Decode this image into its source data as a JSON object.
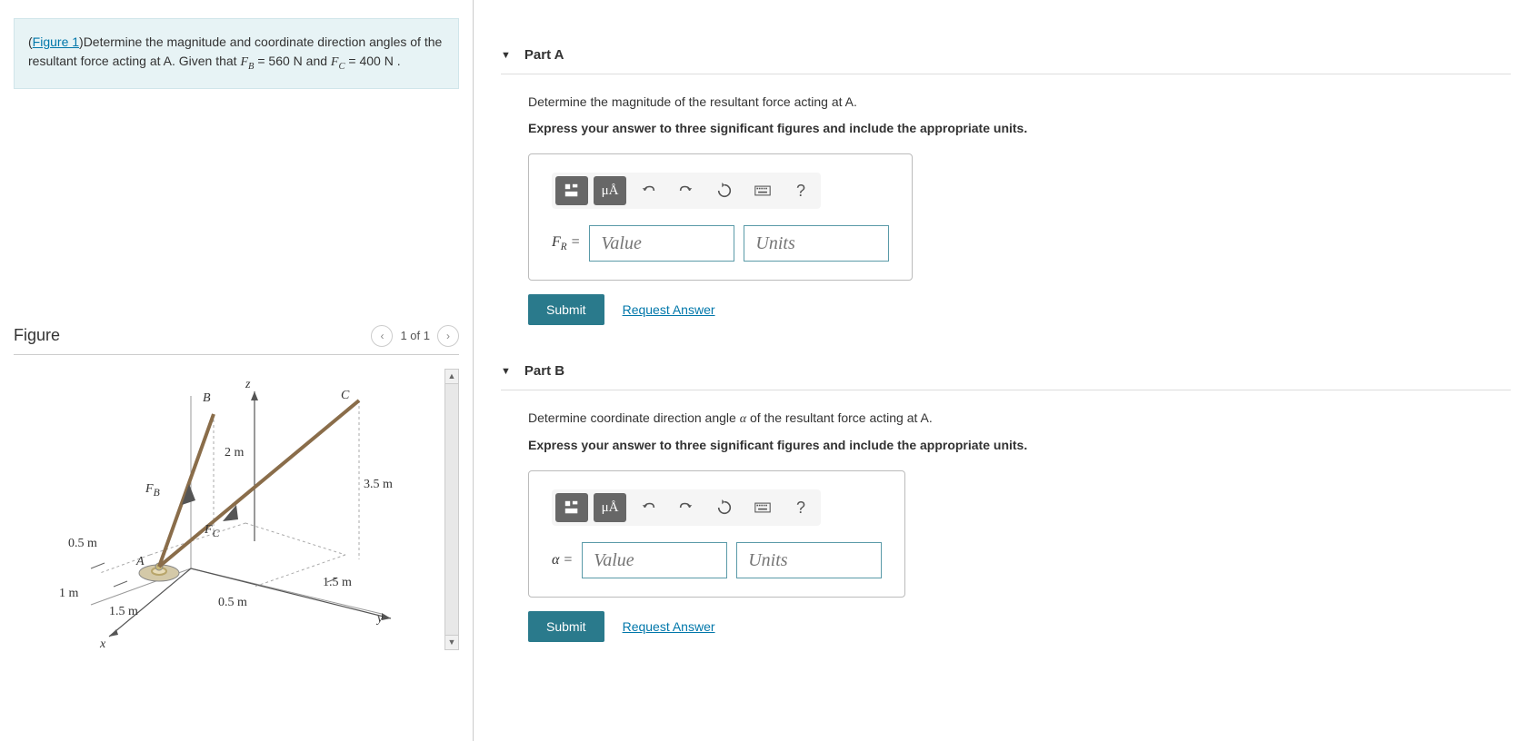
{
  "problem": {
    "figure_link": "Figure 1",
    "text_before": "(",
    "text_after_link": ")Determine the magnitude and coordinate direction angles of the resultant force acting at A. Given that ",
    "fb_var": "F",
    "fb_sub": "B",
    "fb_eq": " = 560 N",
    "and_text": " and ",
    "fc_var": "F",
    "fc_sub": "C",
    "fc_eq": " = 400 N",
    "period": " ."
  },
  "figure": {
    "title": "Figure",
    "nav_count": "1 of 1",
    "labels": {
      "B": "B",
      "C": "C",
      "z": "z",
      "x": "x",
      "y": "y",
      "A": "A",
      "FB": "F",
      "FB_sub": "B",
      "FC": "F",
      "FC_sub": "C",
      "d_2m": "2 m",
      "d_35m": "3.5 m",
      "d_05m_1": "0.5 m",
      "d_05m_2": "0.5 m",
      "d_1m": "1 m",
      "d_15m_1": "1.5 m",
      "d_15m_2": "1.5 m"
    }
  },
  "partA": {
    "title": "Part A",
    "instruction": "Determine the magnitude of the resultant force acting at A.",
    "bold_instruction": "Express your answer to three significant figures and include the appropriate units.",
    "var_label_main": "F",
    "var_label_sub": "R",
    "equals": " = ",
    "value_placeholder": "Value",
    "units_placeholder": "Units",
    "submit": "Submit",
    "request": "Request Answer",
    "toolbar_mu": "μÅ",
    "toolbar_help": "?"
  },
  "partB": {
    "title": "Part B",
    "instruction_before": "Determine coordinate direction angle ",
    "instruction_alpha": "α",
    "instruction_after": " of the resultant force acting at A.",
    "bold_instruction": "Express your answer to three significant figures and include the appropriate units.",
    "var_label": "α",
    "equals": " = ",
    "value_placeholder": "Value",
    "units_placeholder": "Units",
    "submit": "Submit",
    "request": "Request Answer",
    "toolbar_mu": "μÅ",
    "toolbar_help": "?"
  }
}
